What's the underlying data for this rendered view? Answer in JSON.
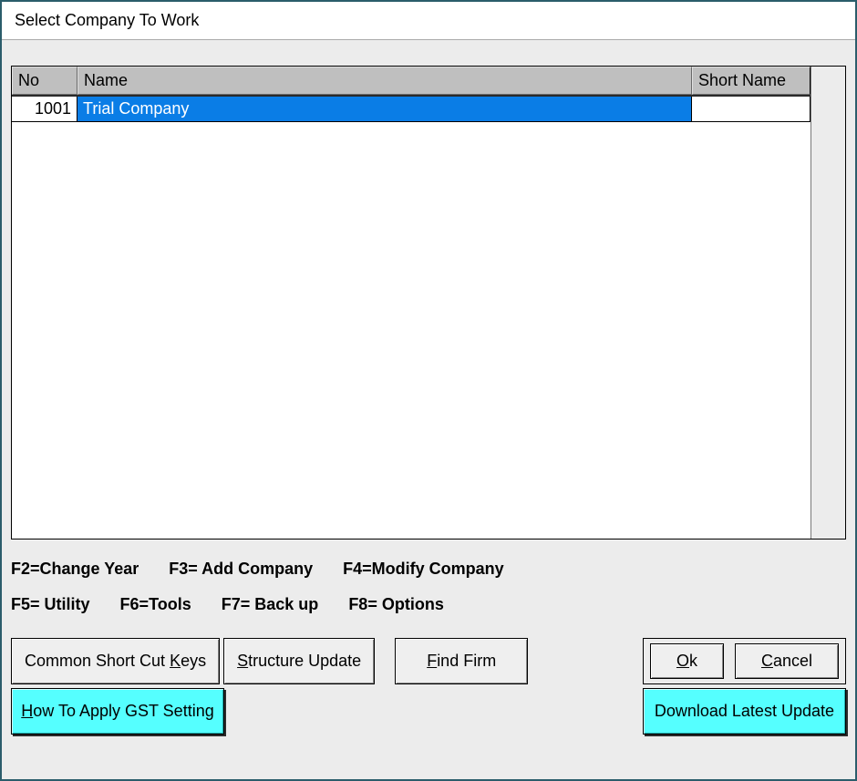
{
  "title": "Select Company To Work",
  "table": {
    "headers": {
      "no": "No",
      "name": "Name",
      "sname": "Short Name"
    },
    "rows": [
      {
        "no": "1001",
        "name": "Trial Company",
        "sname": ""
      }
    ]
  },
  "fkeys": {
    "f2": "F2=Change Year",
    "f3": "F3= Add Company",
    "f4": "F4=Modify Company",
    "f5": "F5= Utility",
    "f6": "F6=Tools",
    "f7": "F7=  Back  up",
    "f8": "F8=  Options"
  },
  "buttons": {
    "shortcut_pre": "Common Short Cut ",
    "shortcut_u": "K",
    "shortcut_post": "eys",
    "structure_u": "S",
    "structure_post": "tructure Update",
    "find_u": "F",
    "find_post": "ind Firm",
    "ok_u": "O",
    "ok_post": "k",
    "cancel_u": "C",
    "cancel_post": "ancel",
    "gst_u": "H",
    "gst_post": "ow To Apply GST Setting",
    "download": "Download Latest Update"
  }
}
